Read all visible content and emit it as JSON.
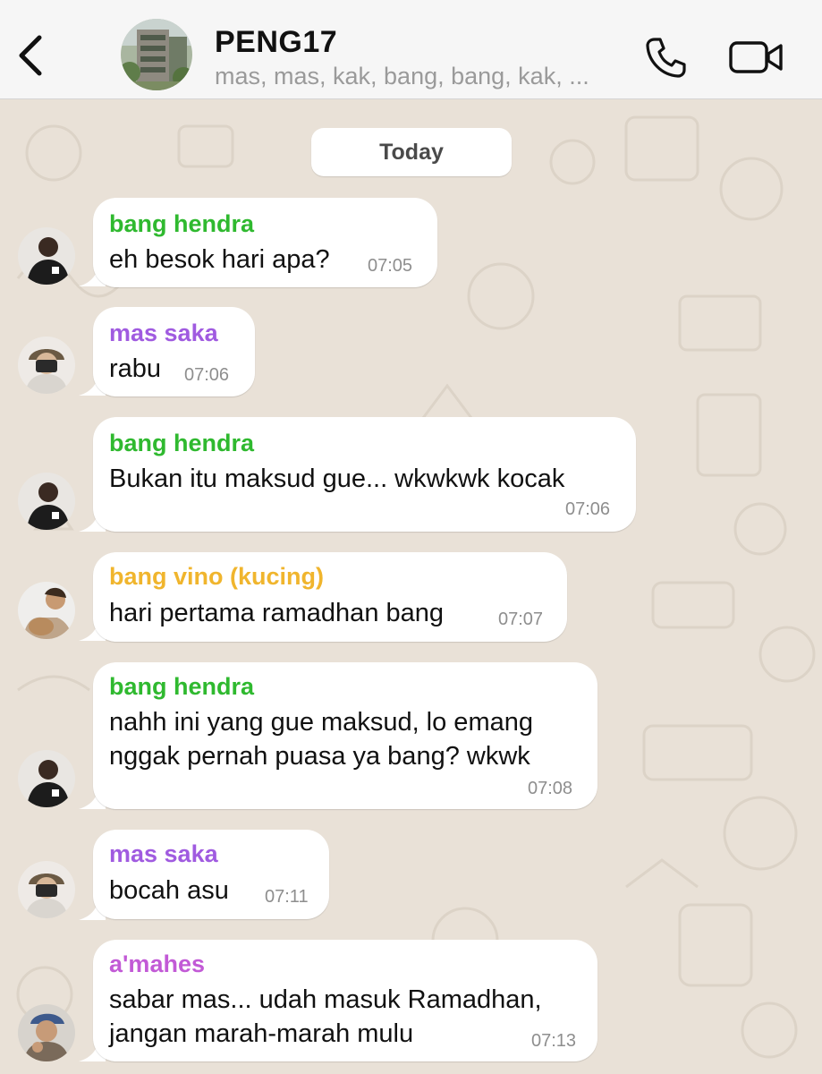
{
  "header": {
    "title": "PENG17",
    "subtitle": "mas, mas, kak, bang, bang, kak, ..."
  },
  "date_separator": "Today",
  "colors": {
    "hendra": "#2fb92f",
    "saka": "#a05be0",
    "vino": "#f0b52d",
    "mahes": "#c25ad6"
  },
  "messages": [
    {
      "sender": "bang hendra",
      "lines": [
        "eh besok hari apa?"
      ],
      "time": "07:05"
    },
    {
      "sender": "mas saka",
      "lines": [
        "rabu"
      ],
      "time": "07:06"
    },
    {
      "sender": "bang hendra",
      "lines": [
        "Bukan itu maksud gue... wkwkwk kocak"
      ],
      "time": "07:06"
    },
    {
      "sender": "bang vino (kucing)",
      "lines": [
        "hari pertama ramadhan bang"
      ],
      "time": "07:07"
    },
    {
      "sender": "bang hendra",
      "lines": [
        "nahh ini yang gue maksud, lo emang",
        "nggak pernah puasa ya bang? wkwk"
      ],
      "time": "07:08"
    },
    {
      "sender": "mas saka",
      "lines": [
        "bocah asu"
      ],
      "time": "07:11"
    },
    {
      "sender": "a'mahes",
      "lines": [
        "sabar mas... udah masuk Ramadhan,",
        "jangan marah-marah mulu"
      ],
      "time": "07:13"
    }
  ]
}
